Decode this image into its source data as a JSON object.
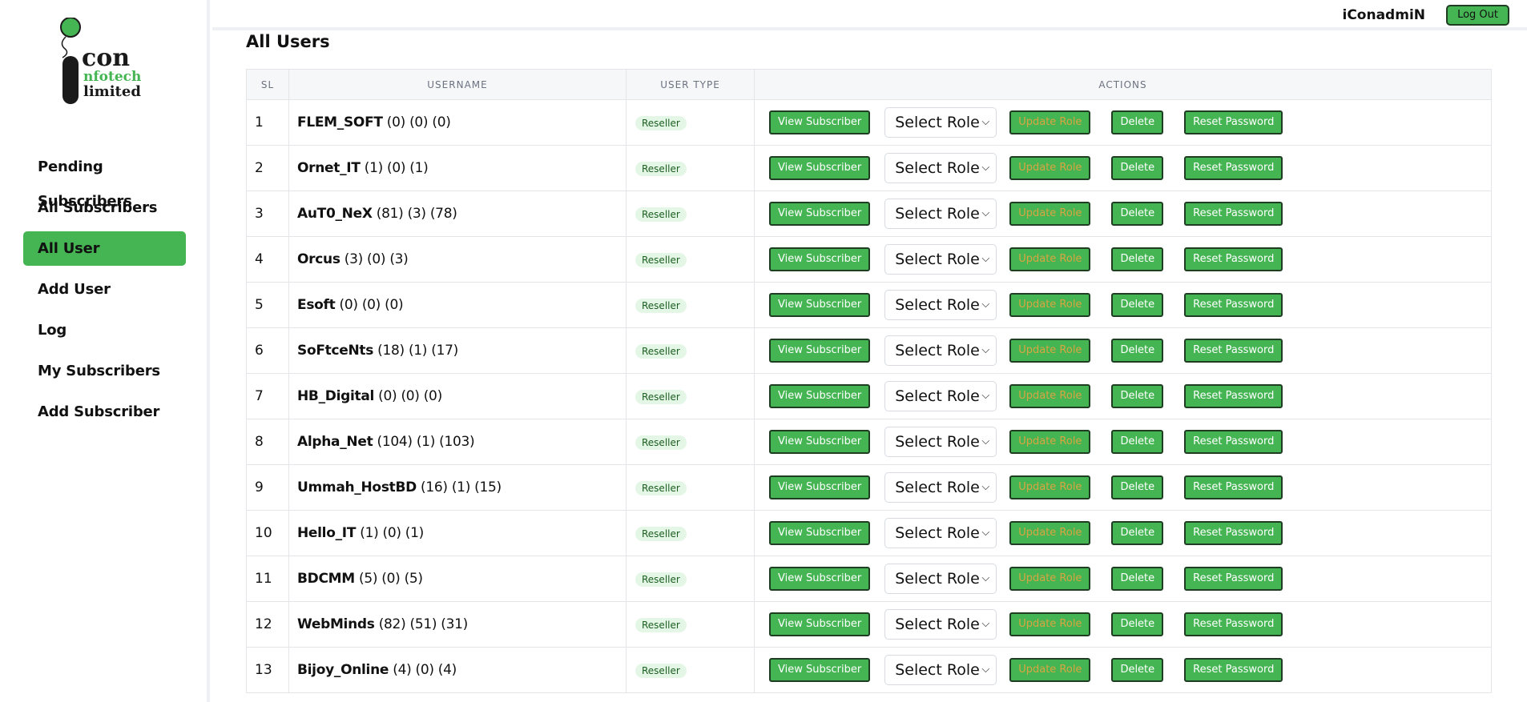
{
  "header": {
    "username": "iConadmiN",
    "logout_label": "Log Out"
  },
  "logo": {
    "line1": "con",
    "line2": "nfotech",
    "line3": "limited",
    "colors": {
      "green": "#45b553",
      "dark": "#1a1a1a"
    }
  },
  "sidebar": {
    "items": [
      {
        "label": "Pending Subscribers",
        "active": false
      },
      {
        "label": "All Subscribers",
        "active": false
      },
      {
        "label": "All User",
        "active": true
      },
      {
        "label": "Add User",
        "active": false
      },
      {
        "label": "Log",
        "active": false
      },
      {
        "label": "My Subscribers",
        "active": false
      },
      {
        "label": "Add Subscriber",
        "active": false
      }
    ]
  },
  "page": {
    "title": "All Users"
  },
  "table": {
    "columns": [
      "SL",
      "USERNAME",
      "USER TYPE",
      "ACTIONS"
    ],
    "actions": {
      "view": "View Subscriber",
      "select_role": "Select Role",
      "update": "Update Role",
      "delete": "Delete",
      "reset": "Reset Password"
    },
    "rows": [
      {
        "sl": "1",
        "name": "FLEM_SOFT",
        "counts": "(0) (0) (0)",
        "type": "Reseller"
      },
      {
        "sl": "2",
        "name": "Ornet_IT",
        "counts": "(1) (0) (1)",
        "type": "Reseller"
      },
      {
        "sl": "3",
        "name": "AuT0_NeX",
        "counts": "(81) (3) (78)",
        "type": "Reseller"
      },
      {
        "sl": "4",
        "name": "Orcus",
        "counts": "(3) (0) (3)",
        "type": "Reseller"
      },
      {
        "sl": "5",
        "name": "Esoft",
        "counts": "(0) (0) (0)",
        "type": "Reseller"
      },
      {
        "sl": "6",
        "name": "SoFtceNts",
        "counts": "(18) (1) (17)",
        "type": "Reseller"
      },
      {
        "sl": "7",
        "name": "HB_Digital",
        "counts": "(0) (0) (0)",
        "type": "Reseller"
      },
      {
        "sl": "8",
        "name": "Alpha_Net",
        "counts": "(104) (1) (103)",
        "type": "Reseller"
      },
      {
        "sl": "9",
        "name": "Ummah_HostBD",
        "counts": "(16) (1) (15)",
        "type": "Reseller"
      },
      {
        "sl": "10",
        "name": "Hello_IT",
        "counts": "(1) (0) (1)",
        "type": "Reseller"
      },
      {
        "sl": "11",
        "name": "BDCMM",
        "counts": "(5) (0) (5)",
        "type": "Reseller"
      },
      {
        "sl": "12",
        "name": "WebMinds",
        "counts": "(82) (51) (31)",
        "type": "Reseller"
      },
      {
        "sl": "13",
        "name": "Bijoy_Online",
        "counts": "(4) (0) (4)",
        "type": "Reseller"
      }
    ]
  }
}
